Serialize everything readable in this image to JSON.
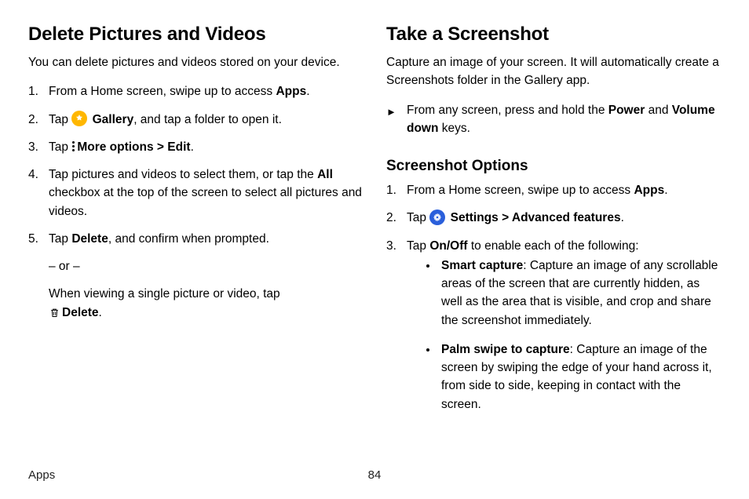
{
  "left": {
    "heading": "Delete Pictures and Videos",
    "intro": "You can delete pictures and videos stored on your device.",
    "step1_pre": "From a Home screen, swipe up to access ",
    "step1_bold": "Apps",
    "step1_post": ".",
    "step2_pre": "Tap ",
    "step2_bold": "Gallery",
    "step2_post": ", and tap a folder to open it.",
    "step3_pre": "Tap ",
    "step3_bold1": "More options",
    "step3_sep": " > ",
    "step3_bold2": "Edit",
    "step3_post": ".",
    "step4_pre": "Tap pictures and videos to select them, or tap the ",
    "step4_bold": "All",
    "step4_post": " checkbox at the top of the screen to select all pictures and videos.",
    "step5_pre": "Tap ",
    "step5_bold": "Delete",
    "step5_post": ", and confirm when prompted.",
    "step5_or": "– or –",
    "step5_alt_pre": "When viewing a single picture or video, tap ",
    "step5_alt_bold": "Delete",
    "step5_alt_post": "."
  },
  "right": {
    "heading": "Take a Screenshot",
    "intro": "Capture an image of your screen. It will automatically create a Screenshots folder in the Gallery app.",
    "tri_pre": "From any screen, press and hold the ",
    "tri_bold1": "Power",
    "tri_mid": " and ",
    "tri_bold2": "Volume down",
    "tri_post": " keys.",
    "subheading": "Screenshot Options",
    "s1_pre": "From a Home screen, swipe up to access ",
    "s1_bold": "Apps",
    "s1_post": ".",
    "s2_pre": "Tap ",
    "s2_bold1": "Settings",
    "s2_sep": " > ",
    "s2_bold2": "Advanced features",
    "s2_post": ".",
    "s3_pre": "Tap ",
    "s3_bold": "On/Off",
    "s3_post": " to enable each of the following:",
    "b1_bold": "Smart capture",
    "b1_text": ": Capture an image of any scrollable areas of the screen that are currently hidden, as well as the area that is visible, and crop and share the screenshot immediately.",
    "b2_bold": "Palm swipe to capture",
    "b2_text": ": Capture an image of the screen by swiping the edge of your hand across it, from side to side, keeping in contact with the screen."
  },
  "footer": {
    "section": "Apps",
    "page": "84"
  }
}
